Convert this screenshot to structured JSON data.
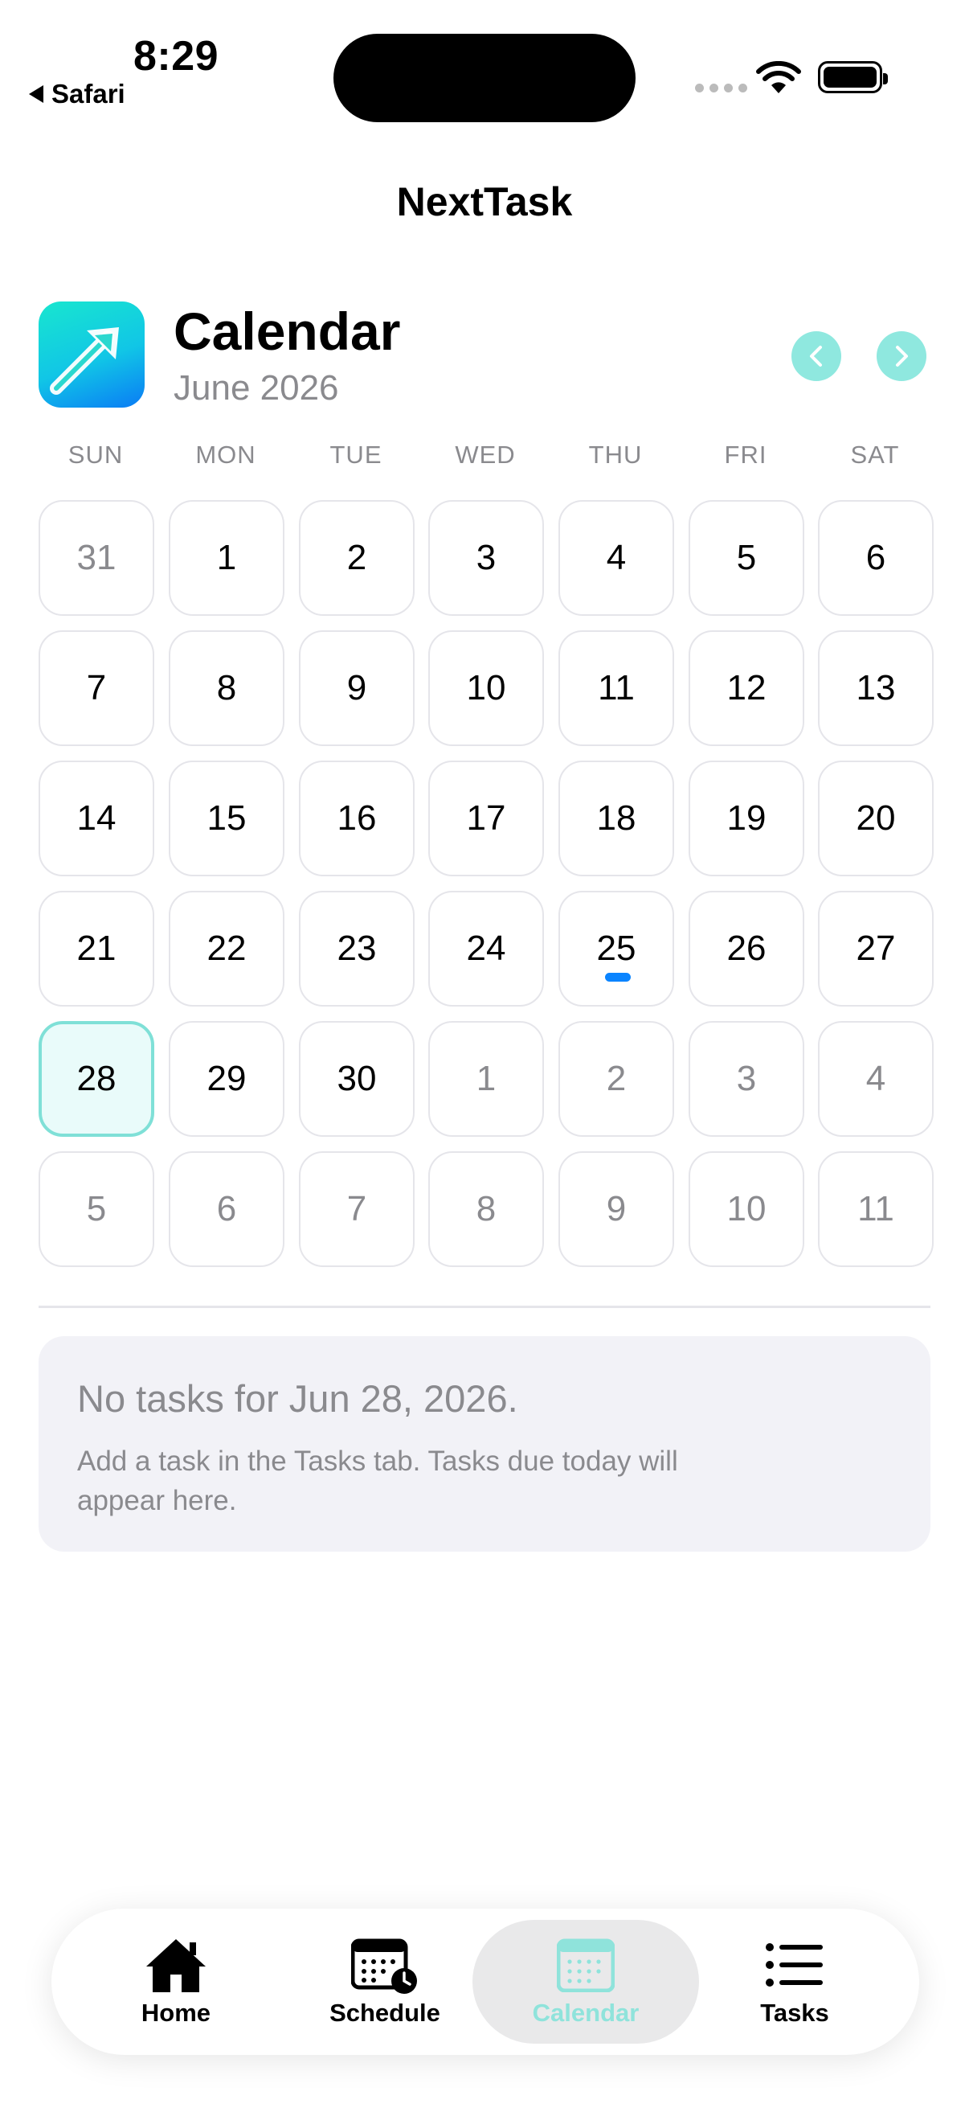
{
  "status": {
    "time": "8:29",
    "back_app": "Safari"
  },
  "nav": {
    "title": "NextTask"
  },
  "header": {
    "title": "Calendar",
    "month": "June 2026"
  },
  "weekdays": [
    "SUN",
    "MON",
    "TUE",
    "WED",
    "THU",
    "FRI",
    "SAT"
  ],
  "weeks": [
    [
      {
        "d": "31",
        "muted": true
      },
      {
        "d": "1"
      },
      {
        "d": "2"
      },
      {
        "d": "3"
      },
      {
        "d": "4"
      },
      {
        "d": "5"
      },
      {
        "d": "6"
      }
    ],
    [
      {
        "d": "7"
      },
      {
        "d": "8"
      },
      {
        "d": "9"
      },
      {
        "d": "10"
      },
      {
        "d": "11"
      },
      {
        "d": "12"
      },
      {
        "d": "13"
      }
    ],
    [
      {
        "d": "14"
      },
      {
        "d": "15"
      },
      {
        "d": "16"
      },
      {
        "d": "17"
      },
      {
        "d": "18"
      },
      {
        "d": "19"
      },
      {
        "d": "20"
      }
    ],
    [
      {
        "d": "21"
      },
      {
        "d": "22"
      },
      {
        "d": "23"
      },
      {
        "d": "24"
      },
      {
        "d": "25",
        "has_task": true
      },
      {
        "d": "26"
      },
      {
        "d": "27"
      }
    ],
    [
      {
        "d": "28",
        "selected": true
      },
      {
        "d": "29"
      },
      {
        "d": "30"
      },
      {
        "d": "1",
        "muted": true
      },
      {
        "d": "2",
        "muted": true
      },
      {
        "d": "3",
        "muted": true
      },
      {
        "d": "4",
        "muted": true
      }
    ],
    [
      {
        "d": "5",
        "muted": true
      },
      {
        "d": "6",
        "muted": true
      },
      {
        "d": "7",
        "muted": true
      },
      {
        "d": "8",
        "muted": true
      },
      {
        "d": "9",
        "muted": true
      },
      {
        "d": "10",
        "muted": true
      },
      {
        "d": "11",
        "muted": true
      }
    ]
  ],
  "empty": {
    "title": "No tasks for Jun 28, 2026.",
    "subtitle": "Add a task in the Tasks tab. Tasks due today will appear here."
  },
  "tabs": [
    {
      "label": "Home",
      "icon": "home-icon",
      "active": false
    },
    {
      "label": "Schedule",
      "icon": "schedule-icon",
      "active": false
    },
    {
      "label": "Calendar",
      "icon": "calendar-icon",
      "active": true
    },
    {
      "label": "Tasks",
      "icon": "list-icon",
      "active": false
    }
  ],
  "colors": {
    "accent": "#8fe8df",
    "selected_bg": "#e9fbfa",
    "task_dot": "#0a84ff",
    "muted_text": "#8a8a8e"
  }
}
